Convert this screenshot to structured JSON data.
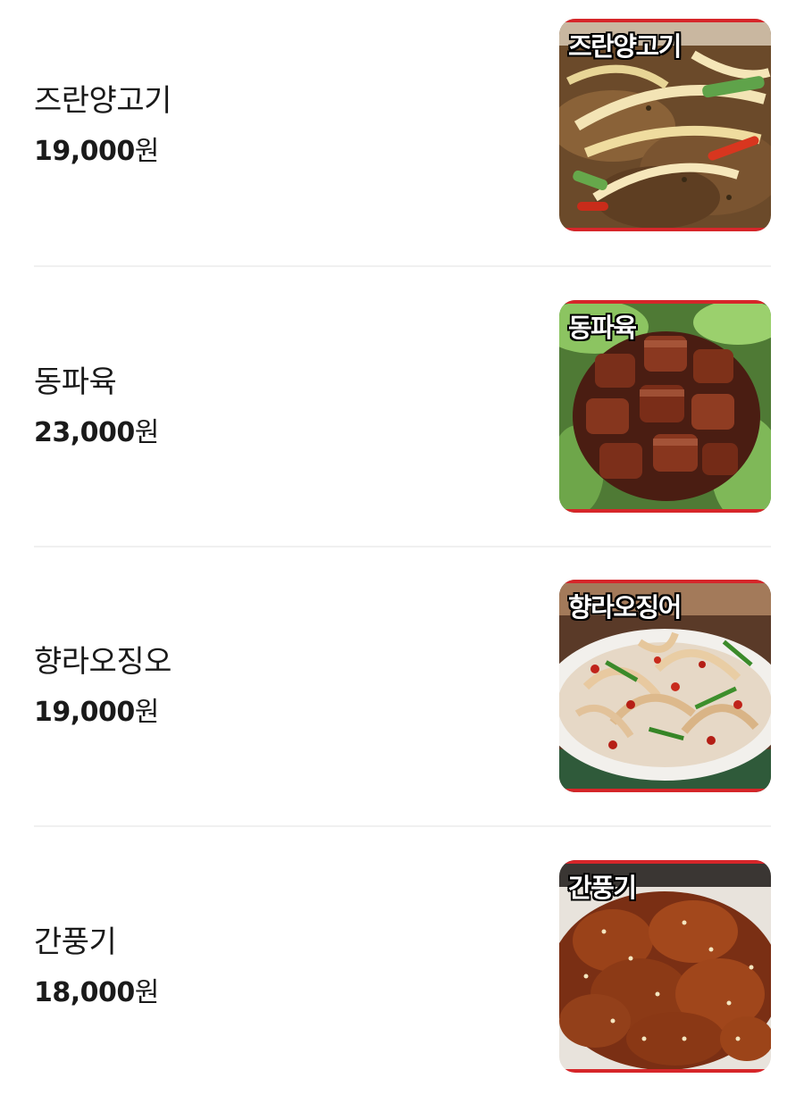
{
  "menu": {
    "items": [
      {
        "name": "즈란양고기",
        "price": "19,000",
        "unit": "원",
        "image_label": "즈란양고기"
      },
      {
        "name": "동파육",
        "price": "23,000",
        "unit": "원",
        "image_label": "동파육"
      },
      {
        "name": "향라오징오",
        "price": "19,000",
        "unit": "원",
        "image_label": "향라오징어"
      },
      {
        "name": "간풍기",
        "price": "18,000",
        "unit": "원",
        "image_label": "간풍기"
      }
    ]
  },
  "colors": {
    "text": "#1a1a1a",
    "divider": "#f0f0f0",
    "image_border_accent": "#d6262a"
  }
}
